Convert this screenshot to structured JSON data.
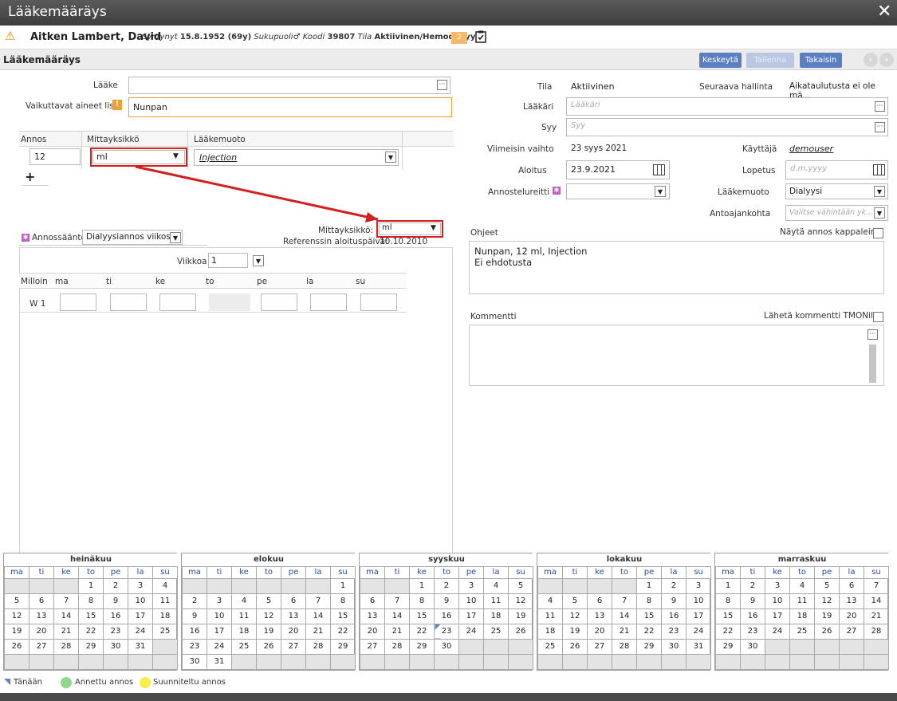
{
  "window": {
    "title": "Lääkemääräys",
    "close": "✕"
  },
  "patient": {
    "name": "Aitken Lambert, David",
    "born_label": "Syntynyt",
    "born_value": "15.8.1952 (69y)",
    "sex_label": "Sukupuoli",
    "sex_icon": "♂",
    "code_label": "Koodi",
    "code_value": "39807",
    "status_label": "Tila",
    "status_value": "Aktiivinen/Hemodialyysi",
    "badge": "2"
  },
  "section": {
    "title": "Lääkemääräys"
  },
  "toolbar": {
    "pause": "Keskeytä",
    "save": "Tallenna",
    "back": "Takaisin"
  },
  "left": {
    "drug_label": "Lääke",
    "drug_value": "",
    "actives_label": "Vaikuttavat aineet lista",
    "actives_value": "Nunpan",
    "dose_header": "Annos",
    "unit_header": "Mittayksikkö",
    "form_header": "Lääkemuoto",
    "dose_value": "12",
    "unit_value": "ml",
    "form_value": "Injection",
    "add": "+",
    "unit2_label": "Mittayksikkö:",
    "unit2_value": "ml",
    "rule_label": "Annossääntö",
    "rule_value": "Dialyysiannos viikossa",
    "ref_label": "Referenssin aloituspäivä:",
    "ref_value": "10.10.2010",
    "week_label": "Viikkoa",
    "week_value": "1",
    "sched_headers": [
      "Milloin",
      "ma",
      "ti",
      "ke",
      "to",
      "pe",
      "la",
      "su"
    ],
    "sched_row": "W 1"
  },
  "right": {
    "state_label": "Tila",
    "state_value": "Aktiivinen",
    "next_label": "Seuraava hallinta",
    "next_value": "Aikataulutusta ei ole mä...",
    "doctor_label": "Lääkäri",
    "doctor_ph": "Lääkäri",
    "reason_label": "Syy",
    "reason_ph": "Syy",
    "lastchange_label": "Viimeisin vaihto",
    "lastchange_value": "23 syys 2021",
    "user_label": "Käyttäjä",
    "user_value": "demouser",
    "start_label": "Aloitus",
    "start_value": "23.9.2021",
    "end_label": "Lopetus",
    "end_ph": "d.m.yyyy",
    "route_label": "Annostelureitti",
    "route_value": "",
    "form_label": "Lääkemuoto",
    "form_value": "Dialyysi",
    "admin_label": "Antoajankohta",
    "admin_ph": "Valitse vähintään yk...",
    "show_units_label": "Näytä annos kappaleina",
    "instructions_label": "Ohjeet",
    "instructions_line1": "Nunpan, 12 ml, Injection",
    "instructions_line2": "Ei ehdotusta",
    "comment_label": "Kommentti",
    "send_comment_label": "Lähetä kommentti TMONille"
  },
  "calendar": {
    "weekdays": [
      "ma",
      "ti",
      "ke",
      "to",
      "pe",
      "la",
      "su"
    ],
    "months": [
      {
        "name": "heinäkuu",
        "rows": [
          [
            "",
            "",
            "",
            "1",
            "2",
            "3",
            "4"
          ],
          [
            "5",
            "6",
            "7",
            "8",
            "9",
            "10",
            "11"
          ],
          [
            "12",
            "13",
            "14",
            "15",
            "16",
            "17",
            "18"
          ],
          [
            "19",
            "20",
            "21",
            "22",
            "23",
            "24",
            "25"
          ],
          [
            "26",
            "27",
            "28",
            "29",
            "30",
            "31",
            ""
          ],
          [
            "",
            "",
            "",
            "",
            "",
            "",
            ""
          ]
        ]
      },
      {
        "name": "elokuu",
        "rows": [
          [
            "",
            "",
            "",
            "",
            "",
            "",
            "1"
          ],
          [
            "2",
            "3",
            "4",
            "5",
            "6",
            "7",
            "8"
          ],
          [
            "9",
            "10",
            "11",
            "12",
            "13",
            "14",
            "15"
          ],
          [
            "16",
            "17",
            "18",
            "19",
            "20",
            "21",
            "22"
          ],
          [
            "23",
            "24",
            "25",
            "26",
            "27",
            "28",
            "29"
          ],
          [
            "30",
            "31",
            "",
            "",
            "",
            "",
            ""
          ]
        ]
      },
      {
        "name": "syyskuu",
        "rows": [
          [
            "",
            "",
            "1",
            "2",
            "3",
            "4",
            "5"
          ],
          [
            "6",
            "7",
            "8",
            "9",
            "10",
            "11",
            "12"
          ],
          [
            "13",
            "14",
            "15",
            "16",
            "17",
            "18",
            "19"
          ],
          [
            "20",
            "21",
            "22",
            "23",
            "24",
            "25",
            "26"
          ],
          [
            "27",
            "28",
            "29",
            "30",
            "",
            "",
            ""
          ],
          [
            "",
            "",
            "",
            "",
            "",
            "",
            ""
          ]
        ]
      },
      {
        "name": "lokakuu",
        "rows": [
          [
            "",
            "",
            "",
            "",
            "1",
            "2",
            "3"
          ],
          [
            "4",
            "5",
            "6",
            "7",
            "8",
            "9",
            "10"
          ],
          [
            "11",
            "12",
            "13",
            "14",
            "15",
            "16",
            "17"
          ],
          [
            "18",
            "19",
            "20",
            "21",
            "22",
            "23",
            "24"
          ],
          [
            "25",
            "26",
            "27",
            "28",
            "29",
            "30",
            "31"
          ],
          [
            "",
            "",
            "",
            "",
            "",
            "",
            ""
          ]
        ]
      },
      {
        "name": "marraskuu",
        "rows": [
          [
            "1",
            "2",
            "3",
            "4",
            "5",
            "6",
            "7"
          ],
          [
            "8",
            "9",
            "10",
            "11",
            "12",
            "13",
            "14"
          ],
          [
            "15",
            "16",
            "17",
            "18",
            "19",
            "20",
            "21"
          ],
          [
            "22",
            "23",
            "24",
            "25",
            "26",
            "27",
            "28"
          ],
          [
            "29",
            "30",
            "",
            "",
            "",
            "",
            ""
          ],
          [
            "",
            "",
            "",
            "",
            "",
            "",
            ""
          ]
        ]
      }
    ],
    "today_month": 2,
    "today_day": "23",
    "legend_today": "Tänään",
    "legend_given": "Annettu annos",
    "legend_planned": "Suunniteltu annos",
    "today_color": "#6a7fc0",
    "given_color": "#8fd98f",
    "planned_color": "#f5f044"
  },
  "colors": {
    "accent_blue": "#5b7fc0",
    "highlight_orange": "#f0a030",
    "annotation_red": "#d41f1f"
  }
}
